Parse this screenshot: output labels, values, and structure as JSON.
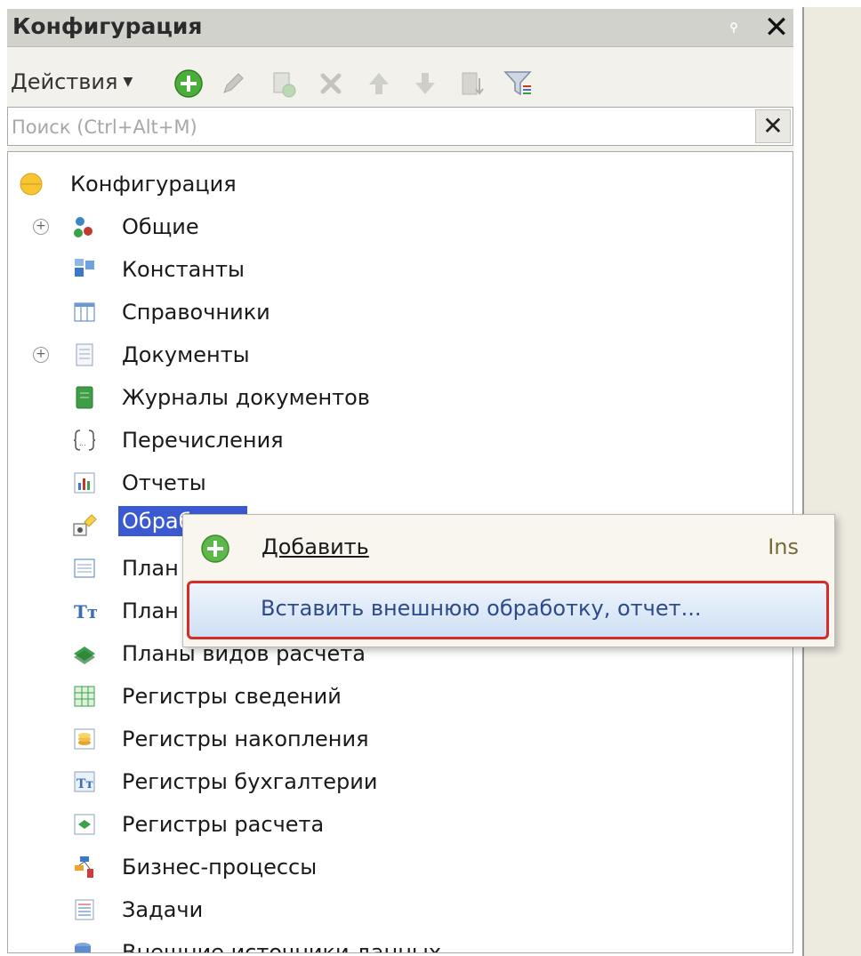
{
  "panel": {
    "title": "Конфигурация"
  },
  "toolbar": {
    "actions_label": "Действия"
  },
  "search": {
    "placeholder": "Поиск (Ctrl+Alt+M)",
    "value": ""
  },
  "tree": {
    "root_label": "Конфигурация",
    "items": [
      {
        "label": "Общие",
        "icon": "common-icon",
        "expandable": true
      },
      {
        "label": "Константы",
        "icon": "constants-icon",
        "expandable": false
      },
      {
        "label": "Справочники",
        "icon": "catalogs-icon",
        "expandable": false
      },
      {
        "label": "Документы",
        "icon": "documents-icon",
        "expandable": true
      },
      {
        "label": "Журналы документов",
        "icon": "document-journals-icon",
        "expandable": false
      },
      {
        "label": "Перечисления",
        "icon": "enumerations-icon",
        "expandable": false
      },
      {
        "label": "Отчеты",
        "icon": "reports-icon",
        "expandable": false
      },
      {
        "label": "Обработки",
        "icon": "data-processors-icon",
        "expandable": false,
        "selected": true
      },
      {
        "label": "План",
        "icon": "chart-of-characteristics-icon",
        "expandable": false
      },
      {
        "label": "План",
        "icon": "chart-of-accounts-icon",
        "expandable": false
      },
      {
        "label": "Планы видов расчета",
        "icon": "chart-of-calculation-types-icon",
        "expandable": false
      },
      {
        "label": "Регистры сведений",
        "icon": "information-registers-icon",
        "expandable": false
      },
      {
        "label": "Регистры накопления",
        "icon": "accumulation-registers-icon",
        "expandable": false
      },
      {
        "label": "Регистры бухгалтерии",
        "icon": "accounting-registers-icon",
        "expandable": false
      },
      {
        "label": "Регистры расчета",
        "icon": "calculation-registers-icon",
        "expandable": false
      },
      {
        "label": "Бизнес-процессы",
        "icon": "business-processes-icon",
        "expandable": false
      },
      {
        "label": "Задачи",
        "icon": "tasks-icon",
        "expandable": false
      },
      {
        "label": "Внешние источники данных",
        "icon": "external-data-sources-icon",
        "expandable": false
      }
    ]
  },
  "context_menu": {
    "add_label": "Добавить",
    "add_shortcut": "Ins",
    "insert_label": "Вставить внешнюю обработку, отчет..."
  },
  "colors": {
    "selection": "#3b5ad1",
    "highlight_border": "#d42b2b"
  }
}
